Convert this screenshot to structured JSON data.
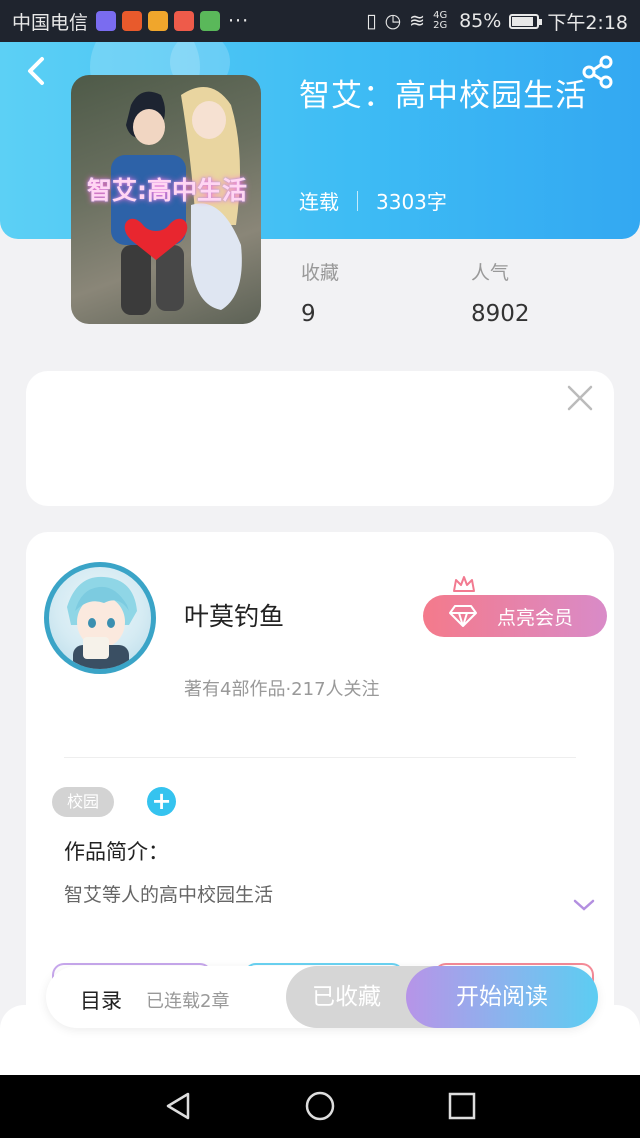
{
  "status_bar": {
    "carrier": "中国电信",
    "more": "···",
    "network": "4G 2G",
    "battery": "85%",
    "battery_level": 0.85,
    "time": "下午2:18"
  },
  "header": {
    "title": "智艾：高中校园生活",
    "status": "连载",
    "word_count": "3303字"
  },
  "cover": {
    "overlay_text": "智艾:高中生活"
  },
  "stats": {
    "favorites_label": "收藏",
    "favorites_value": "9",
    "popularity_label": "人气",
    "popularity_value": "8902"
  },
  "author": {
    "name": "叶莫钓鱼",
    "summary": "著有4部作品·217人关注",
    "vip_label": "点亮会员"
  },
  "tags": [
    "校园"
  ],
  "intro": {
    "label": "作品简介：",
    "text": "智艾等人的高中校园生活"
  },
  "bottom": {
    "toc_label": "目录",
    "toc_sub": "已连载2章",
    "favorited_label": "已收藏",
    "read_label": "开始阅读"
  },
  "colors": {
    "header_gradient": [
      "#5cd0f5",
      "#33a8f2"
    ],
    "vip_gradient": [
      "#f47a8b",
      "#d98bc8"
    ],
    "read_gradient": [
      "#b794e8",
      "#5ccdf2"
    ],
    "accent": "#35c3ef"
  }
}
